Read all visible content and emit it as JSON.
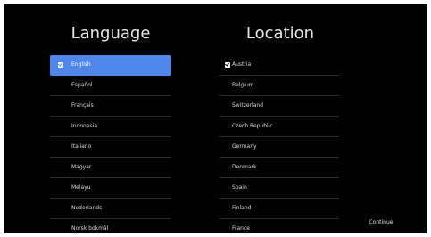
{
  "language": {
    "heading": "Language",
    "items": [
      {
        "label": "English",
        "selected": true
      },
      {
        "label": "Español",
        "selected": false
      },
      {
        "label": "Français",
        "selected": false
      },
      {
        "label": "Indonesia",
        "selected": false
      },
      {
        "label": "Italiano",
        "selected": false
      },
      {
        "label": "Magyar",
        "selected": false
      },
      {
        "label": "Melayu",
        "selected": false
      },
      {
        "label": "Nederlands",
        "selected": false
      },
      {
        "label": "Norsk bokmål",
        "selected": false
      }
    ]
  },
  "location": {
    "heading": "Location",
    "items": [
      {
        "label": "Austria",
        "selected": true
      },
      {
        "label": "Belgium",
        "selected": false
      },
      {
        "label": "Switzerland",
        "selected": false
      },
      {
        "label": "Czech Republic",
        "selected": false
      },
      {
        "label": "Germany",
        "selected": false
      },
      {
        "label": "Denmark",
        "selected": false
      },
      {
        "label": "Spain",
        "selected": false
      },
      {
        "label": "Finland",
        "selected": false
      },
      {
        "label": "France",
        "selected": false
      }
    ]
  },
  "continue_label": "Continue",
  "colors": {
    "background": "#000000",
    "selected_item": "#4f86ea",
    "text": "#dcdcdc"
  },
  "icons": {
    "checked": "checkbox-checked-icon"
  }
}
